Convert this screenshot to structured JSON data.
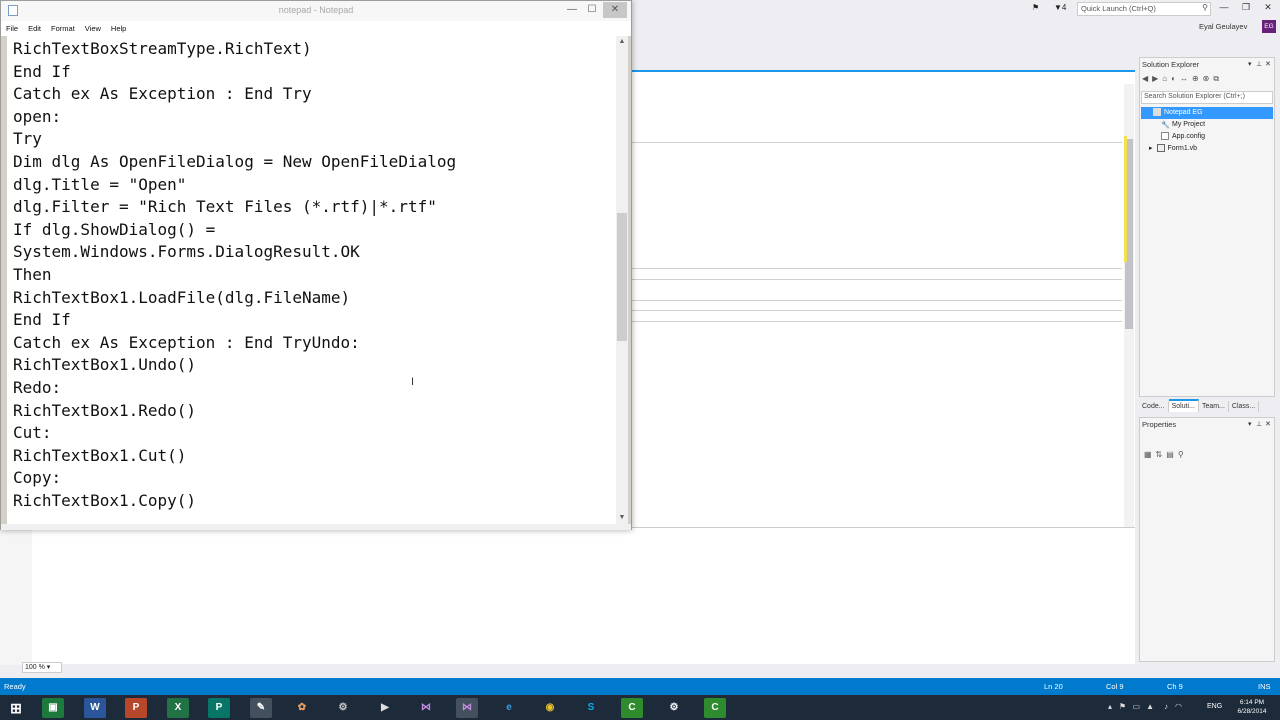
{
  "notepad": {
    "title": "notepad - Notepad",
    "menu": [
      "File",
      "Edit",
      "Format",
      "View",
      "Help"
    ],
    "content": "RichTextBoxStreamType.RichText)\nEnd If\nCatch ex As Exception : End Try\nopen:\nTry\nDim dlg As OpenFileDialog = New OpenFileDialog\ndlg.Title = \"Open\"\ndlg.Filter = \"Rich Text Files (*.rtf)|*.rtf\"\nIf dlg.ShowDialog() =\nSystem.Windows.Forms.DialogResult.OK\nThen\nRichTextBox1.LoadFile(dlg.FileName)\nEnd If\nCatch ex As Exception : End TryUndo:\nRichTextBox1.Undo()\nRedo:\nRichTextBox1.Redo()\nCut:\nRichTextBox1.Cut()\nCopy:\nRichTextBox1.Copy()",
    "window_controls": {
      "minimize": "—",
      "maximize": "☐",
      "close": "✕"
    }
  },
  "vs": {
    "quick_launch_placeholder": "Quick Launch (Ctrl+Q)",
    "notification_count": "4",
    "user_name": "Eyal Geulayev",
    "user_initials": "EG",
    "zoom": "100 %",
    "solution_explorer": {
      "title": "Solution Explorer",
      "search_placeholder": "Search Solution Explorer (Ctrl+;)",
      "items": [
        {
          "label": "Notepad EG",
          "selected": true
        },
        {
          "label": "My Project",
          "selected": false
        },
        {
          "label": "App.config",
          "selected": false
        },
        {
          "label": "Form1.vb",
          "selected": false
        }
      ],
      "tabs": [
        "Code...",
        "Soluti...",
        "Team...",
        "Class..."
      ]
    },
    "properties": {
      "title": "Properties"
    },
    "status": {
      "ready": "Ready",
      "line": "Ln 20",
      "col": "Col 9",
      "ch": "Ch 9",
      "mode": "INS"
    }
  },
  "taskbar": {
    "items": [
      "start",
      "excel",
      "word",
      "powerpoint",
      "excel2",
      "publisher",
      "notepad",
      "paint",
      "tool",
      "media",
      "visual-studio",
      "visual-studio-2",
      "internet-explorer",
      "chrome",
      "skype",
      "camtasia",
      "settings",
      "camtasia-recorder"
    ],
    "language": "ENG",
    "time": "6:14 PM",
    "date": "6/28/2014"
  },
  "colors": {
    "status_bar": "#007acc",
    "accent": "#1c97ea",
    "taskbar": "#1c2a3a"
  }
}
